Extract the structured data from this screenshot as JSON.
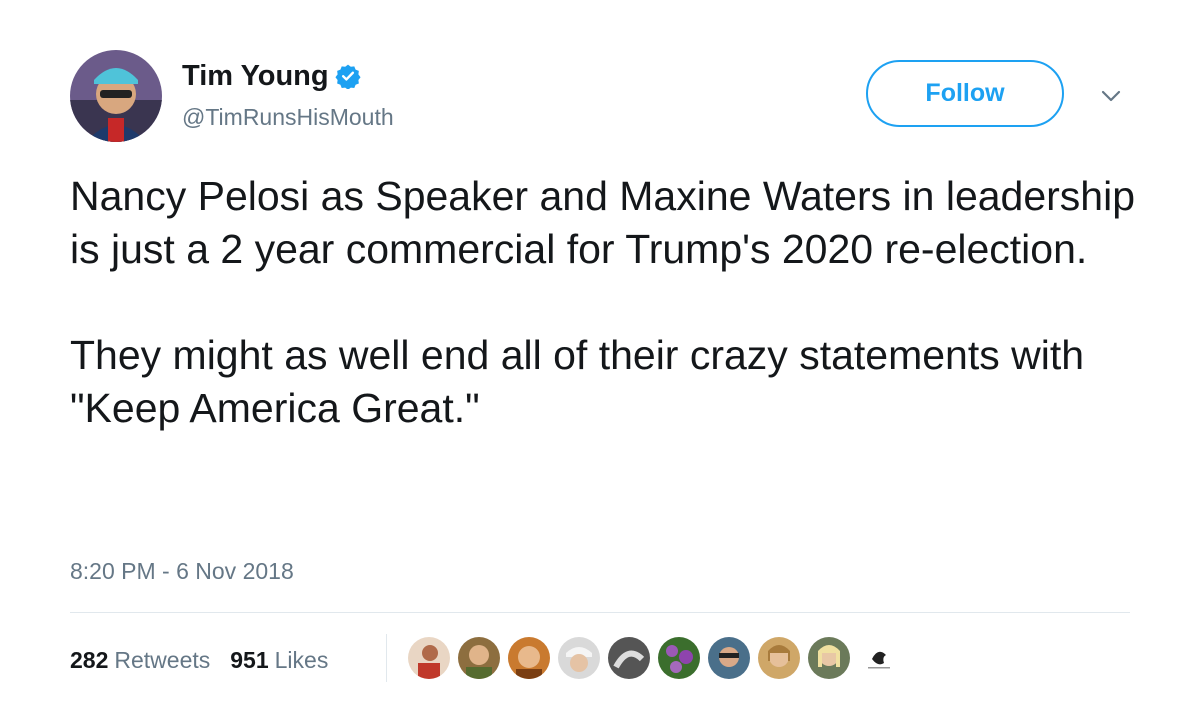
{
  "author": {
    "name": "Tim Young",
    "handle": "@TimRunsHisMouth",
    "verified": true
  },
  "follow_label": "Follow",
  "tweet": {
    "paragraphs": [
      "Nancy Pelosi as Speaker and Maxine Waters in leadership is just a 2 year commercial for Trump's 2020 re-election.",
      "They might as well end all of their crazy statements with \"Keep America Great.\""
    ],
    "timestamp": "8:20 PM - 6 Nov 2018"
  },
  "stats": {
    "retweets_count": "282",
    "retweets_label": "Retweets",
    "likes_count": "951",
    "likes_label": "Likes"
  },
  "colors": {
    "accent": "#1da1f2",
    "muted": "#657786",
    "text": "#14171a",
    "divider": "#e1e8ed"
  },
  "likers_icons": [
    "liker-avatar",
    "liker-avatar",
    "liker-avatar",
    "liker-avatar",
    "liker-avatar",
    "liker-avatar",
    "liker-avatar",
    "liker-avatar",
    "liker-avatar",
    "liker-avatar"
  ]
}
